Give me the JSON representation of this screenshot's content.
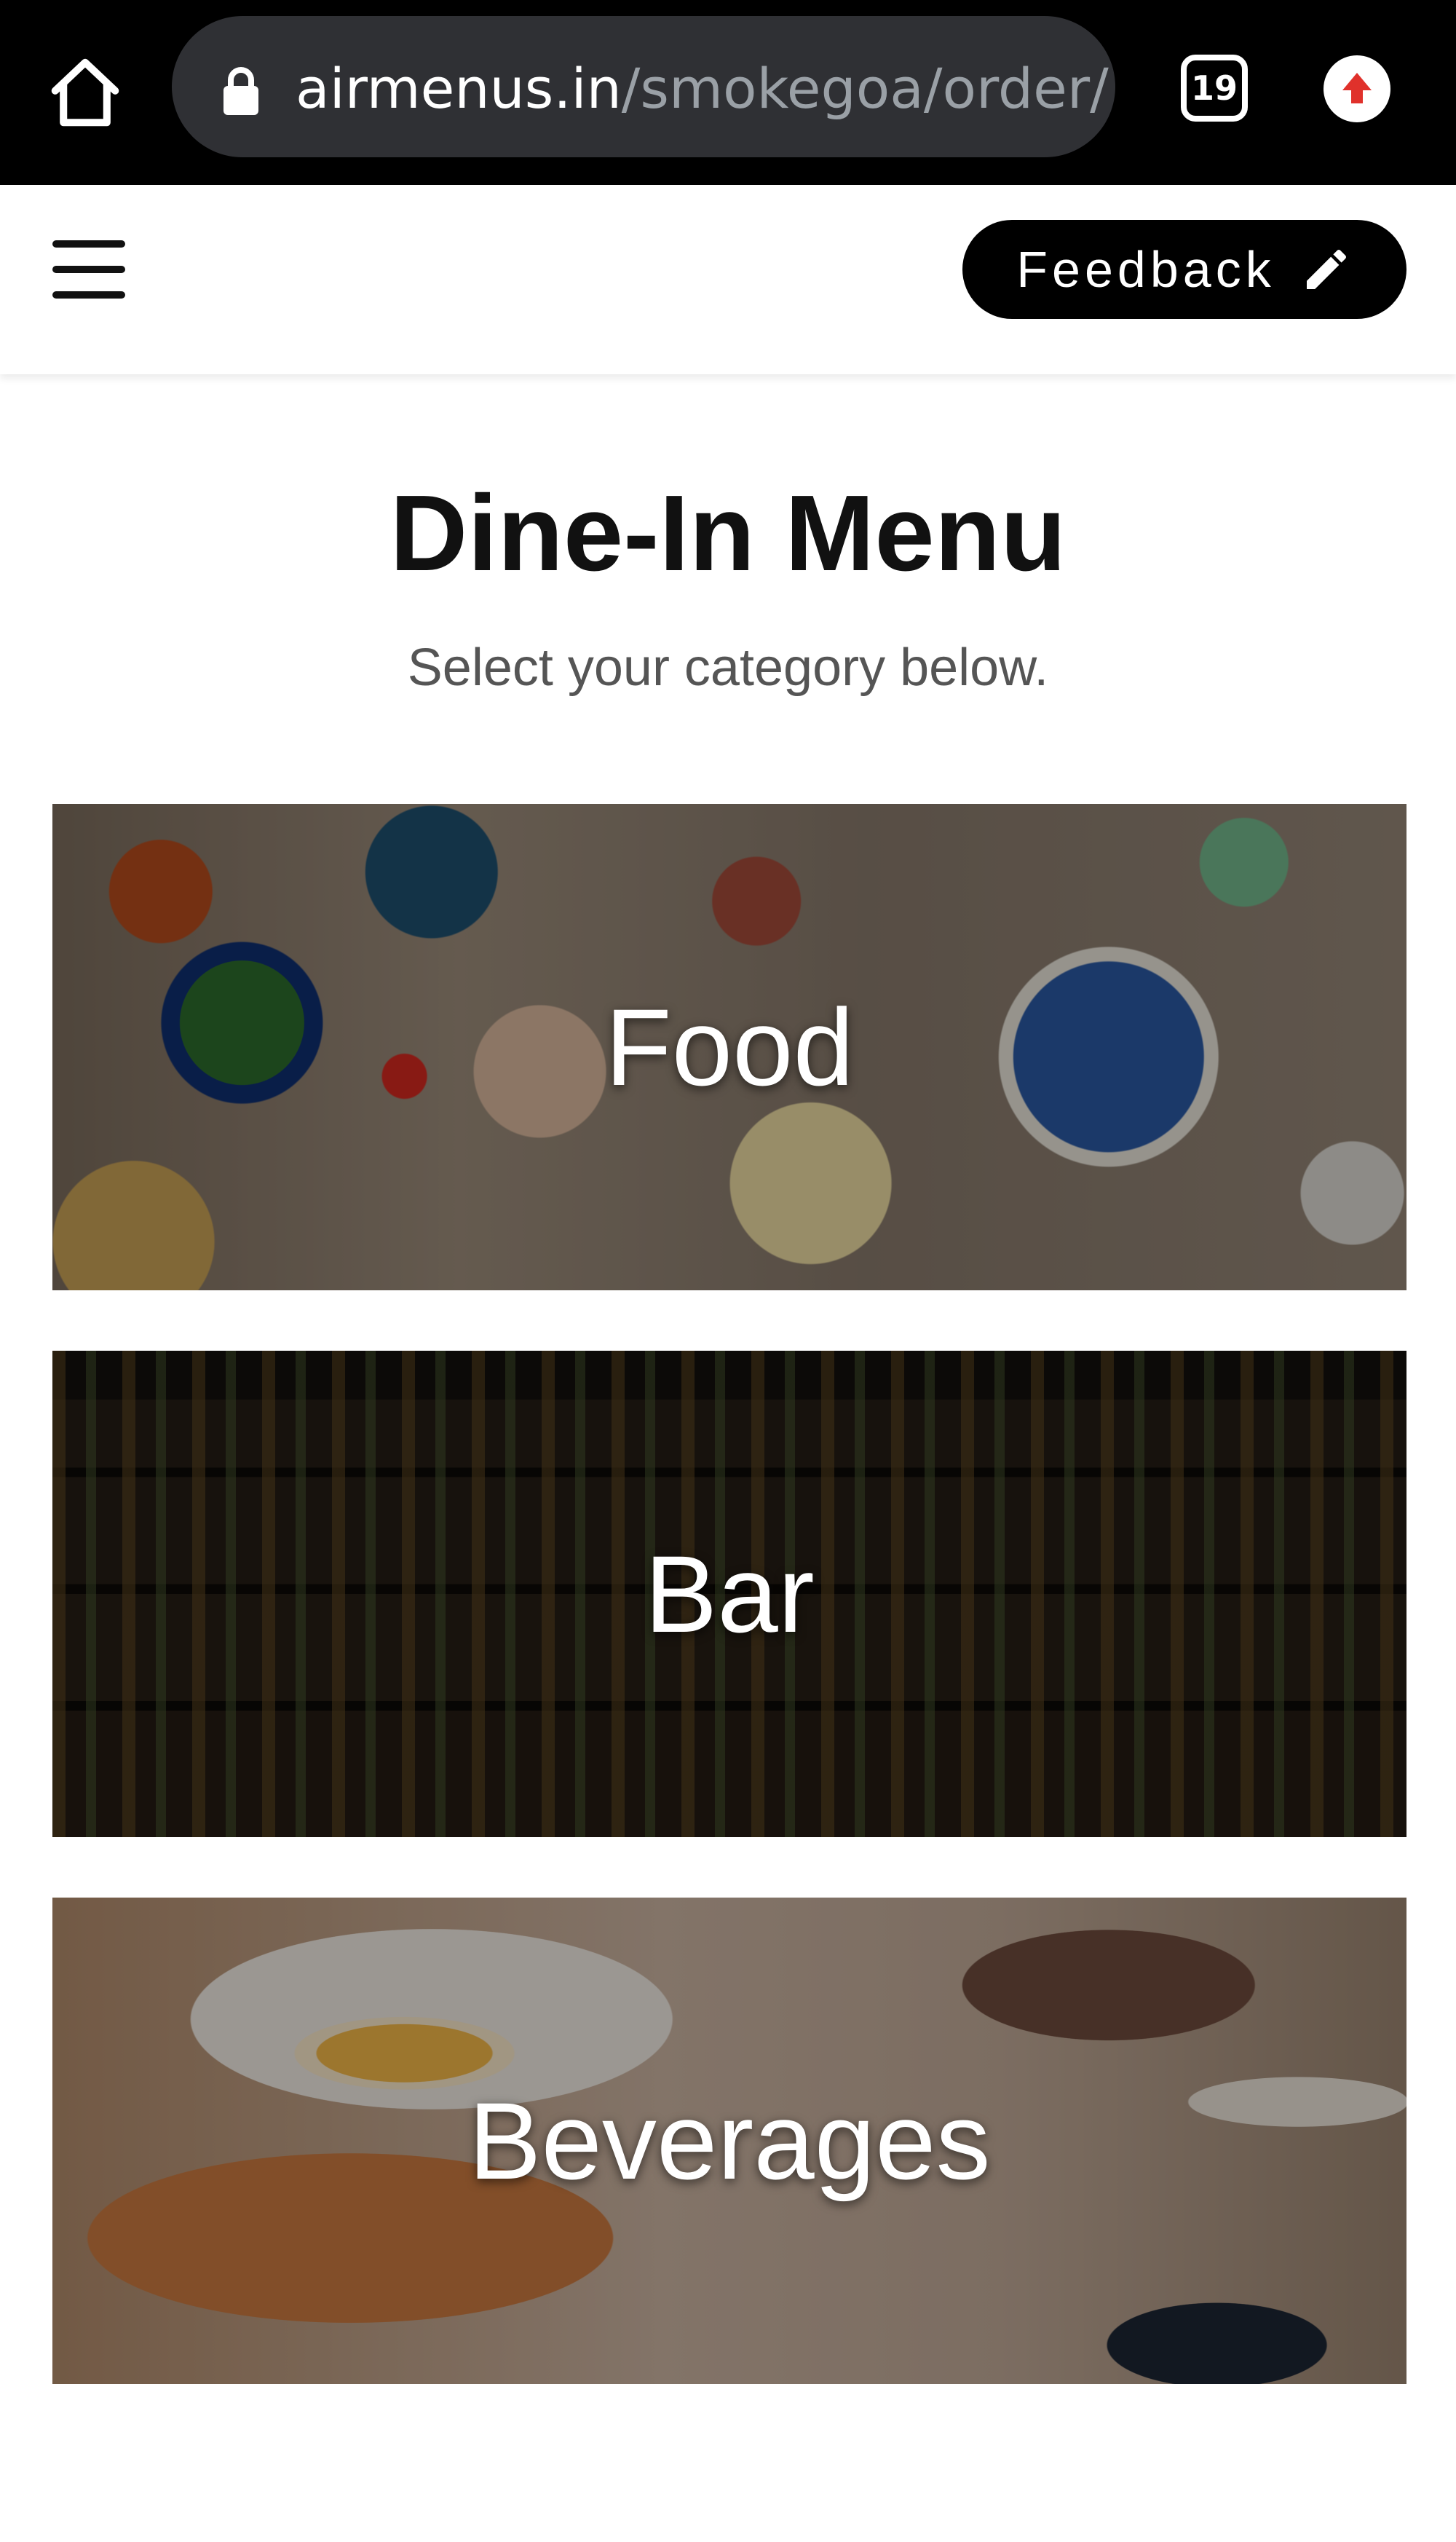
{
  "browser": {
    "url_domain": "airmenus.in",
    "url_path": "/smokegoa/order/",
    "tab_count": "19"
  },
  "header": {
    "feedback_label": "Feedback"
  },
  "page": {
    "title": "Dine-In Menu",
    "subtitle": "Select your category below."
  },
  "categories": [
    {
      "label": "Food"
    },
    {
      "label": "Bar"
    },
    {
      "label": "Beverages"
    }
  ]
}
